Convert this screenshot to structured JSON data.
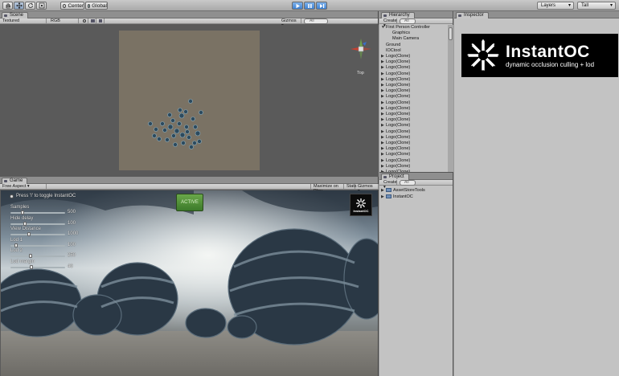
{
  "toolbar": {
    "hand_icon": "hand-icon",
    "move_icon": "move-icon",
    "rotate_icon": "rotate-icon",
    "scale_icon": "scale-icon",
    "pivot_label": "Center",
    "space_label": "Global",
    "play_icon": "play-icon",
    "pause_icon": "pause-icon",
    "step_icon": "step-icon",
    "layers_label": "Layers",
    "layout_label": "Tall"
  },
  "scene": {
    "tab_label": "Scene",
    "render_mode": "Textured",
    "color_mode": "RGB",
    "gizmos_label": "Gizmos",
    "search_placeholder": "All",
    "view_label": "Top"
  },
  "game": {
    "tab_label": "Game",
    "aspect_label": "Free Aspect",
    "maximize_label": "Maximize on Play",
    "stats_label": "Stats",
    "gizmos_label": "Gizmos",
    "toggle_text": "Press 'I' to toggle InstantOC",
    "active_button": "ACTIVE",
    "sliders": [
      {
        "label": "Samples",
        "value": "500",
        "fraction": 0.2
      },
      {
        "label": "Hide delay",
        "value": "100",
        "fraction": 0.25
      },
      {
        "label": "View Distance",
        "value": "1000",
        "fraction": 0.33
      },
      {
        "label": "Lod 1",
        "value": "100",
        "fraction": 0.08
      },
      {
        "label": "Lod 2",
        "value": "250",
        "fraction": 0.36
      },
      {
        "label": "Lod margin",
        "value": "40",
        "fraction": 0.38
      }
    ],
    "logo_text": "InstantOC"
  },
  "hierarchy": {
    "tab_label": "Hierarchy",
    "create_label": "Create",
    "search_placeholder": "All",
    "items": [
      {
        "label": "First Person Controller",
        "indent": 0,
        "expanded": true
      },
      {
        "label": "Graphics",
        "indent": 1,
        "expanded": null
      },
      {
        "label": "Main Camera",
        "indent": 1,
        "expanded": null
      },
      {
        "label": "Ground",
        "indent": 0,
        "expanded": null
      },
      {
        "label": "IOCtool",
        "indent": 0,
        "expanded": null
      },
      {
        "label": "Logo(Clone)",
        "indent": 0,
        "expanded": false
      },
      {
        "label": "Logo(Clone)",
        "indent": 0,
        "expanded": false
      },
      {
        "label": "Logo(Clone)",
        "indent": 0,
        "expanded": false
      },
      {
        "label": "Logo(Clone)",
        "indent": 0,
        "expanded": false
      },
      {
        "label": "Logo(Clone)",
        "indent": 0,
        "expanded": false
      },
      {
        "label": "Logo(Clone)",
        "indent": 0,
        "expanded": false
      },
      {
        "label": "Logo(Clone)",
        "indent": 0,
        "expanded": false
      },
      {
        "label": "Logo(Clone)",
        "indent": 0,
        "expanded": false
      },
      {
        "label": "Logo(Clone)",
        "indent": 0,
        "expanded": false
      },
      {
        "label": "Logo(Clone)",
        "indent": 0,
        "expanded": false
      },
      {
        "label": "Logo(Clone)",
        "indent": 0,
        "expanded": false
      },
      {
        "label": "Logo(Clone)",
        "indent": 0,
        "expanded": false
      },
      {
        "label": "Logo(Clone)",
        "indent": 0,
        "expanded": false
      },
      {
        "label": "Logo(Clone)",
        "indent": 0,
        "expanded": false
      },
      {
        "label": "Logo(Clone)",
        "indent": 0,
        "expanded": false
      },
      {
        "label": "Logo(Clone)",
        "indent": 0,
        "expanded": false
      },
      {
        "label": "Logo(Clone)",
        "indent": 0,
        "expanded": false
      },
      {
        "label": "Logo(Clone)",
        "indent": 0,
        "expanded": false
      },
      {
        "label": "Logo(Clone)",
        "indent": 0,
        "expanded": false
      },
      {
        "label": "Logo(Clone)",
        "indent": 0,
        "expanded": false
      },
      {
        "label": "Logo(Clone)",
        "indent": 0,
        "expanded": false
      },
      {
        "label": "Logo(Clone)",
        "indent": 0,
        "expanded": false
      },
      {
        "label": "Logo(Clone)",
        "indent": 0,
        "expanded": false
      }
    ]
  },
  "project": {
    "tab_label": "Project",
    "create_label": "Create",
    "search_placeholder": "All",
    "items": [
      {
        "label": "AssetStoreTools"
      },
      {
        "label": "InstantOC"
      }
    ]
  },
  "inspector": {
    "tab_label": "Inspector",
    "logo_title": "InstantOC",
    "logo_subtitle": "dynamic occlusion culling + lod"
  }
}
